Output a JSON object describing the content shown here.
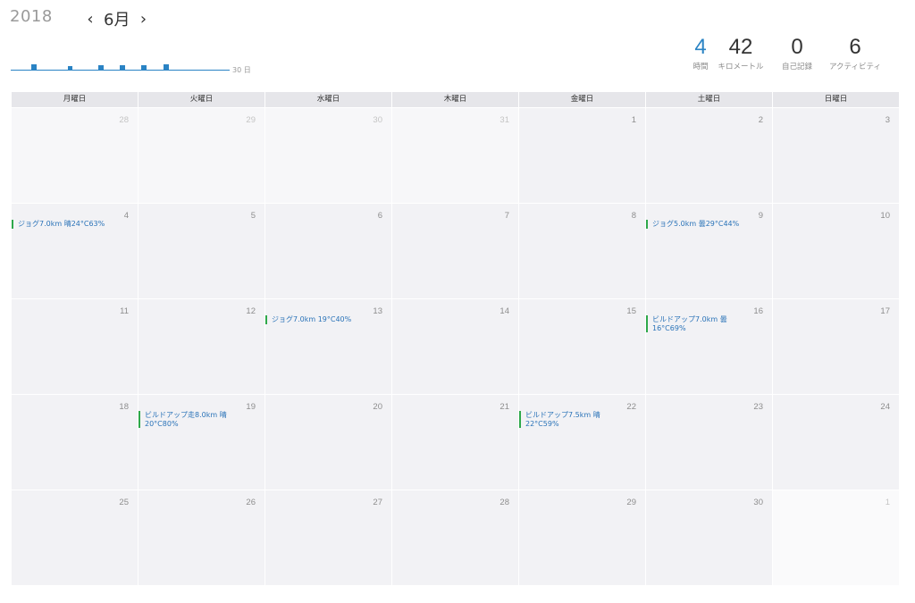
{
  "header": {
    "year": "2018",
    "month": "6月",
    "prev_icon": "chevron-left-icon",
    "next_icon": "chevron-right-icon"
  },
  "sparkline": {
    "label": "30 日",
    "color": "#2a83c4"
  },
  "stats": [
    {
      "value": "4",
      "label": "時間"
    },
    {
      "value": "42",
      "label": "キロメートル"
    },
    {
      "value": "0",
      "label": "自己記録"
    },
    {
      "value": "6",
      "label": "アクティビティ"
    }
  ],
  "weekdays": [
    "月曜日",
    "火曜日",
    "水曜日",
    "木曜日",
    "金曜日",
    "土曜日",
    "日曜日"
  ],
  "weeks": [
    [
      {
        "day": "28"
      },
      {
        "day": "29"
      },
      {
        "day": "30"
      },
      {
        "day": "31"
      },
      {
        "day": "1"
      },
      {
        "day": "2"
      },
      {
        "day": "3"
      }
    ],
    [
      {
        "day": "4",
        "event": "ジョグ7.0km 晴24°C63%"
      },
      {
        "day": "5"
      },
      {
        "day": "6"
      },
      {
        "day": "7"
      },
      {
        "day": "8"
      },
      {
        "day": "9",
        "event": "ジョグ5.0km 曇29°C44%"
      },
      {
        "day": "10"
      }
    ],
    [
      {
        "day": "11"
      },
      {
        "day": "12"
      },
      {
        "day": "13",
        "event": "ジョグ7.0km 19°C40%"
      },
      {
        "day": "14"
      },
      {
        "day": "15"
      },
      {
        "day": "16",
        "event": "ビルドアップ7.0km 曇16°C69%"
      },
      {
        "day": "17"
      }
    ],
    [
      {
        "day": "18"
      },
      {
        "day": "19",
        "event": "ビルドアップ走8.0km 晴20°C80%"
      },
      {
        "day": "20"
      },
      {
        "day": "21"
      },
      {
        "day": "22",
        "event": "ビルドアップ7.5km 晴22°C59%"
      },
      {
        "day": "23"
      },
      {
        "day": "24"
      }
    ],
    [
      {
        "day": "25"
      },
      {
        "day": "26"
      },
      {
        "day": "27"
      },
      {
        "day": "28"
      },
      {
        "day": "29"
      },
      {
        "day": "30"
      },
      {
        "day": "1"
      }
    ]
  ]
}
